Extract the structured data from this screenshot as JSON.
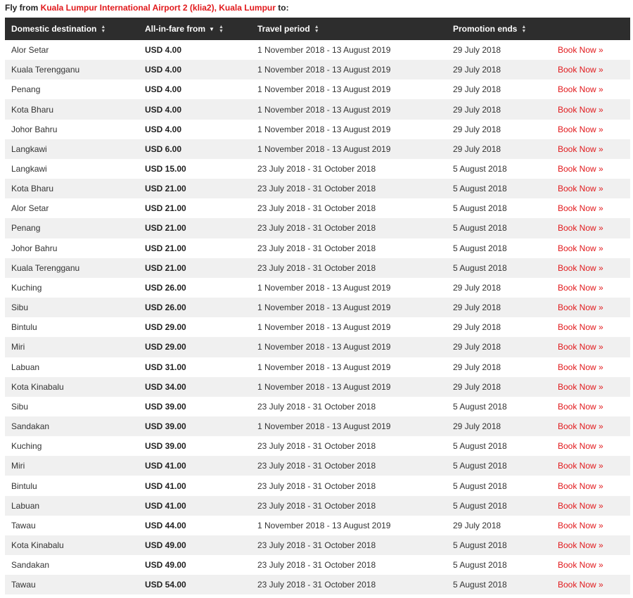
{
  "heading": {
    "prefix": "Fly from ",
    "origin": "Kuala Lumpur International Airport 2 (klia2), Kuala Lumpur",
    "suffix": " to:"
  },
  "colors": {
    "accent": "#e1191c",
    "header_bg": "#2d2d2d",
    "stripe": "#f0f0f0"
  },
  "table": {
    "columns": [
      "Domestic destination",
      "All-in-fare from",
      "Travel period",
      "Promotion ends",
      ""
    ],
    "book_label": "Book Now »",
    "rows": [
      [
        "Alor Setar",
        "USD 4.00",
        "1 November 2018 - 13 August 2019",
        "29 July 2018"
      ],
      [
        "Kuala Terengganu",
        "USD 4.00",
        "1 November 2018 - 13 August 2019",
        "29 July 2018"
      ],
      [
        "Penang",
        "USD 4.00",
        "1 November 2018 - 13 August 2019",
        "29 July 2018"
      ],
      [
        "Kota Bharu",
        "USD 4.00",
        "1 November 2018 - 13 August 2019",
        "29 July 2018"
      ],
      [
        "Johor Bahru",
        "USD 4.00",
        "1 November 2018 - 13 August 2019",
        "29 July 2018"
      ],
      [
        "Langkawi",
        "USD 6.00",
        "1 November 2018 - 13 August 2019",
        "29 July 2018"
      ],
      [
        "Langkawi",
        "USD 15.00",
        "23 July 2018 - 31 October 2018",
        "5 August 2018"
      ],
      [
        "Kota Bharu",
        "USD 21.00",
        "23 July 2018 - 31 October 2018",
        "5 August 2018"
      ],
      [
        "Alor Setar",
        "USD 21.00",
        "23 July 2018 - 31 October 2018",
        "5 August 2018"
      ],
      [
        "Penang",
        "USD 21.00",
        "23 July 2018 - 31 October 2018",
        "5 August 2018"
      ],
      [
        "Johor Bahru",
        "USD 21.00",
        "23 July 2018 - 31 October 2018",
        "5 August 2018"
      ],
      [
        "Kuala Terengganu",
        "USD 21.00",
        "23 July 2018 - 31 October 2018",
        "5 August 2018"
      ],
      [
        "Kuching",
        "USD 26.00",
        "1 November 2018 - 13 August 2019",
        "29 July 2018"
      ],
      [
        "Sibu",
        "USD 26.00",
        "1 November 2018 - 13 August 2019",
        "29 July 2018"
      ],
      [
        "Bintulu",
        "USD 29.00",
        "1 November 2018 - 13 August 2019",
        "29 July 2018"
      ],
      [
        "Miri",
        "USD 29.00",
        "1 November 2018 - 13 August 2019",
        "29 July 2018"
      ],
      [
        "Labuan",
        "USD 31.00",
        "1 November 2018 - 13 August 2019",
        "29 July 2018"
      ],
      [
        "Kota Kinabalu",
        "USD 34.00",
        "1 November 2018 - 13 August 2019",
        "29 July 2018"
      ],
      [
        "Sibu",
        "USD 39.00",
        "23 July 2018 - 31 October 2018",
        "5 August 2018"
      ],
      [
        "Sandakan",
        "USD 39.00",
        "1 November 2018 - 13 August 2019",
        "29 July 2018"
      ],
      [
        "Kuching",
        "USD 39.00",
        "23 July 2018 - 31 October 2018",
        "5 August 2018"
      ],
      [
        "Miri",
        "USD 41.00",
        "23 July 2018 - 31 October 2018",
        "5 August 2018"
      ],
      [
        "Bintulu",
        "USD 41.00",
        "23 July 2018 - 31 October 2018",
        "5 August 2018"
      ],
      [
        "Labuan",
        "USD 41.00",
        "23 July 2018 - 31 October 2018",
        "5 August 2018"
      ],
      [
        "Tawau",
        "USD 44.00",
        "1 November 2018 - 13 August 2019",
        "29 July 2018"
      ],
      [
        "Kota Kinabalu",
        "USD 49.00",
        "23 July 2018 - 31 October 2018",
        "5 August 2018"
      ],
      [
        "Sandakan",
        "USD 49.00",
        "23 July 2018 - 31 October 2018",
        "5 August 2018"
      ],
      [
        "Tawau",
        "USD 54.00",
        "23 July 2018 - 31 October 2018",
        "5 August 2018"
      ]
    ]
  }
}
